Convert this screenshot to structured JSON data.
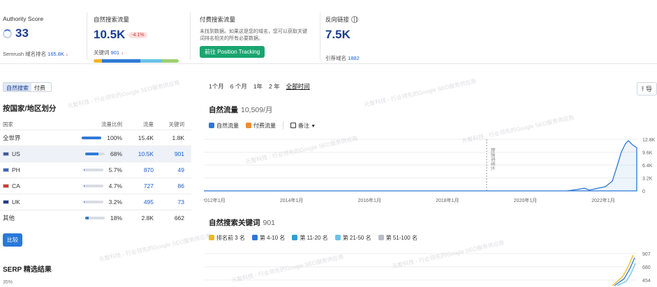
{
  "authority": {
    "title": "Authority Score",
    "value": "33",
    "rank_label": "Semrush 域名排名",
    "rank_value": "165.8K",
    "rank_arrow": "↓"
  },
  "organic": {
    "title": "自然搜索流量",
    "value": "10.5K",
    "change": "-4.1%",
    "kw_label": "关键词",
    "kw_value": "901",
    "kw_arrow": "↓"
  },
  "paid": {
    "title": "付费搜索流量",
    "desc": "未找到数据。如果这是您的域名，您可以获取关键词排名相关的所有必要数据。",
    "button": "前往 Position Tracking"
  },
  "backlinks": {
    "title": "反向链接",
    "value": "7.5K",
    "ref_label": "引荐域名",
    "ref_value": "1882"
  },
  "left": {
    "tabs": [
      "自然搜索",
      "付费"
    ],
    "section_title": "按国家/地区划分",
    "headers": [
      "国家",
      "流量比例",
      "流量",
      "关键词"
    ],
    "rows": [
      {
        "name": "全世界",
        "share": "100%",
        "share_frac": 1.0,
        "traffic": "15.4K",
        "kw": "1.8K"
      },
      {
        "name": "US",
        "share": "68%",
        "share_frac": 0.68,
        "traffic": "10.5K",
        "kw": "901"
      },
      {
        "name": "PH",
        "share": "5.7%",
        "share_frac": 0.057,
        "traffic": "870",
        "kw": "49"
      },
      {
        "name": "CA",
        "share": "4.7%",
        "share_frac": 0.047,
        "traffic": "727",
        "kw": "86"
      },
      {
        "name": "UK",
        "share": "3.2%",
        "share_frac": 0.032,
        "traffic": "495",
        "kw": "73"
      },
      {
        "name": "其他",
        "share": "18%",
        "share_frac": 0.18,
        "traffic": "2.8K",
        "kw": "662"
      }
    ],
    "compare_button": "比较",
    "serp_title": "SERP 精选结果",
    "serp_pct": "35%"
  },
  "right": {
    "ranges": [
      "1个月",
      "6 个月",
      "1年",
      "2 年",
      "全部时间"
    ],
    "share_label": "⤒ 导",
    "traffic_title": "自然流量",
    "traffic_sub": "10,509/月",
    "legend1": [
      "自然流量",
      "付费流量",
      "备注"
    ],
    "y_ticks": [
      "12.8K",
      "9.6K",
      "6.4K",
      "3.2K",
      "0"
    ],
    "x_ticks": [
      "2012年1月",
      "2014年1月",
      "2016年1月",
      "2018年1月",
      "2020年1月",
      "2022年1月"
    ],
    "marker_label": "数据库增长",
    "kw_title": "自然搜索关键词",
    "kw_sub": "901",
    "legend2": [
      "排名前 3 名",
      "第 4-10 名",
      "第 11-20 名",
      "第 21-50 名",
      "第 51-100 名"
    ],
    "y2_ticks": [
      "907",
      "680",
      "454"
    ]
  },
  "watermark": "元智科技 - 行业领先的Google SEO服务供应商",
  "colors": {
    "accent": "#1a3d8f",
    "blue": "#2a78d8",
    "orange": "#f08c2a",
    "green": "#19a56f"
  }
}
